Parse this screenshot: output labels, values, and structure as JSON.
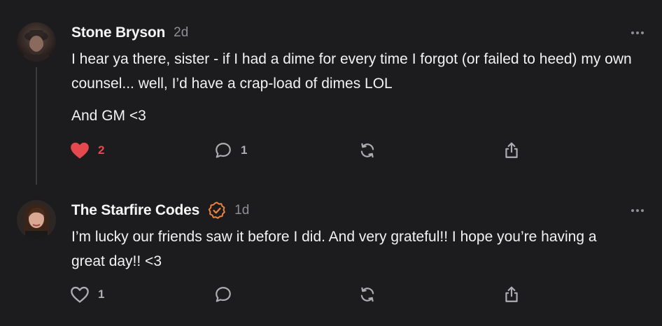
{
  "accent": {
    "like_red": "#e5484d",
    "verified_orange": "#f0833a",
    "muted": "#8e8e93"
  },
  "posts": [
    {
      "author": "Stone Bryson",
      "time": "2d",
      "verified": false,
      "paragraphs": [
        "I hear ya there, sister - if I had a dime for every time I forgot (or failed to heed) my own counsel... well, I’d have a crap-load of dimes LOL",
        "And GM <3"
      ],
      "actions": {
        "like_icon": "heart-filled-icon",
        "like_count": "2",
        "liked": true,
        "reply_icon": "speech-bubble-icon",
        "reply_count": "1",
        "repost_icon": "repost-icon",
        "share_icon": "share-icon"
      },
      "more_icon": "more-horizontal-icon"
    },
    {
      "author": "The Starfire Codes",
      "time": "1d",
      "verified": true,
      "paragraphs": [
        "I’m lucky our friends saw it before I did. And very grateful!! I hope you’re having a great day!! <3"
      ],
      "actions": {
        "like_icon": "heart-outline-icon",
        "like_count": "1",
        "liked": false,
        "reply_icon": "speech-bubble-icon",
        "reply_count": "",
        "repost_icon": "repost-icon",
        "share_icon": "share-icon"
      },
      "more_icon": "more-horizontal-icon"
    }
  ]
}
